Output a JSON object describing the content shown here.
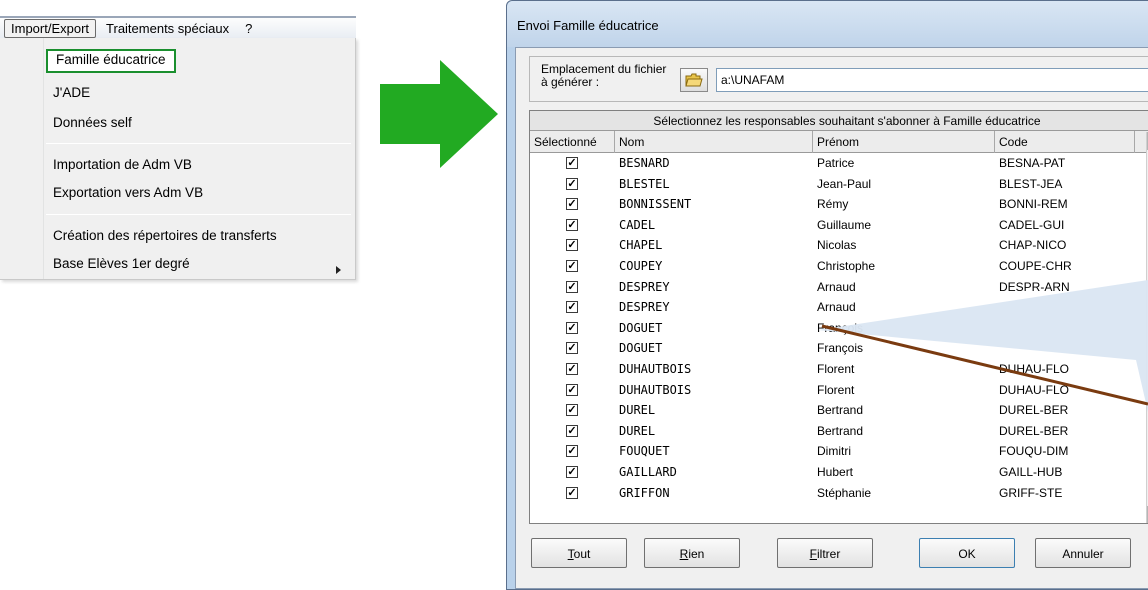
{
  "menubar": {
    "items": [
      "Import/Export",
      "Traitements spéciaux",
      "?"
    ]
  },
  "menu": {
    "items": [
      "Famille éducatrice",
      "J'ADE",
      "Données self",
      "Importation de Adm VB",
      "Exportation vers Adm VB",
      "Création des répertoires de transferts",
      "Base Elèves 1er degré"
    ],
    "highlight_color": "#1a8f2e"
  },
  "arrow_color": "#22aa22",
  "dialog": {
    "title": "Envoi Famille éducatrice",
    "location_label": "Emplacement du fichier à générer :",
    "path_value": "a:\\UNAFAM",
    "grid_caption": "Sélectionnez les responsables souhaitant s'abonner à Famille éducatrice",
    "columns": [
      "Sélectionné",
      "Nom",
      "Prénom",
      "Code"
    ],
    "rows": [
      {
        "checked": true,
        "nom": "BESNARD",
        "prenom": "Patrice",
        "code": "BESNA-PAT"
      },
      {
        "checked": true,
        "nom": "BLESTEL",
        "prenom": "Jean-Paul",
        "code": "BLEST-JEA"
      },
      {
        "checked": true,
        "nom": "BONNISSENT",
        "prenom": "Rémy",
        "code": "BONNI-REM"
      },
      {
        "checked": true,
        "nom": "CADEL",
        "prenom": "Guillaume",
        "code": "CADEL-GUI"
      },
      {
        "checked": true,
        "nom": "CHAPEL",
        "prenom": "Nicolas",
        "code": "CHAP-NICO"
      },
      {
        "checked": true,
        "nom": "COUPEY",
        "prenom": "Christophe",
        "code": "COUPE-CHR"
      },
      {
        "checked": true,
        "nom": "DESPREY",
        "prenom": "Arnaud",
        "code": "DESPR-ARN"
      },
      {
        "checked": true,
        "nom": "DESPREY",
        "prenom": "Arnaud",
        "code": ""
      },
      {
        "checked": true,
        "nom": "DOGUET",
        "prenom": "François",
        "code": ""
      },
      {
        "checked": true,
        "nom": "DOGUET",
        "prenom": "François",
        "code": ""
      },
      {
        "checked": true,
        "nom": "DUHAUTBOIS",
        "prenom": "Florent",
        "code": "DUHAU-FLO"
      },
      {
        "checked": true,
        "nom": "DUHAUTBOIS",
        "prenom": "Florent",
        "code": "DUHAU-FLO"
      },
      {
        "checked": true,
        "nom": "DUREL",
        "prenom": "Bertrand",
        "code": "DUREL-BER"
      },
      {
        "checked": true,
        "nom": "DUREL",
        "prenom": "Bertrand",
        "code": "DUREL-BER"
      },
      {
        "checked": true,
        "nom": "FOUQUET",
        "prenom": "Dimitri",
        "code": "FOUQU-DIM"
      },
      {
        "checked": true,
        "nom": "GAILLARD",
        "prenom": "Hubert",
        "code": "GAILL-HUB"
      },
      {
        "checked": true,
        "nom": "GRIFFON",
        "prenom": "Stéphanie",
        "code": "GRIFF-STE"
      }
    ],
    "buttons": {
      "tout": {
        "accel": "T",
        "rest": "out"
      },
      "rien": {
        "accel": "R",
        "rest": "ien"
      },
      "filtrer": {
        "accel": "F",
        "rest": "iltrer"
      },
      "ok": "OK",
      "annuler": "Annuler"
    },
    "callout_fill": "#dbe6f2",
    "callout_line_color": "#7a3b10"
  }
}
